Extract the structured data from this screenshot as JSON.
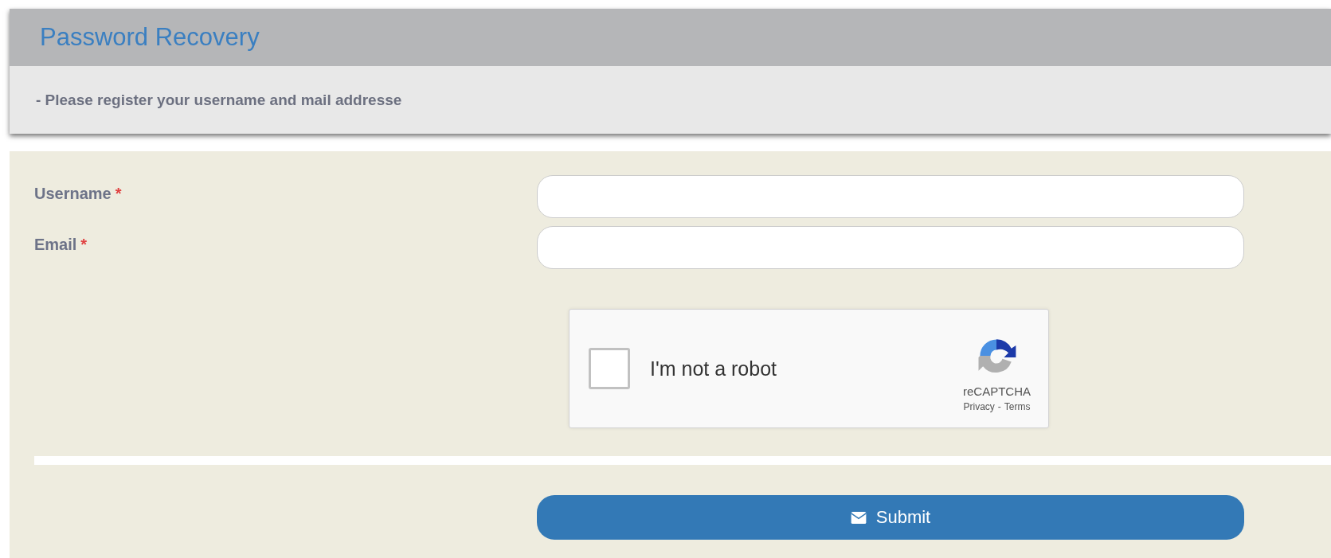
{
  "header": {
    "title": "Password Recovery",
    "instruction": "- Please register your username and mail addresse"
  },
  "fields": [
    {
      "label": "Username",
      "required_mark": "*"
    },
    {
      "label": "Email",
      "required_mark": "*"
    }
  ],
  "captcha": {
    "label": "I'm not a robot",
    "checked": false,
    "brand": "reCAPTCHA",
    "privacy": "Privacy",
    "separator": "-",
    "terms": "Terms"
  },
  "submit": {
    "label": "Submit"
  }
}
